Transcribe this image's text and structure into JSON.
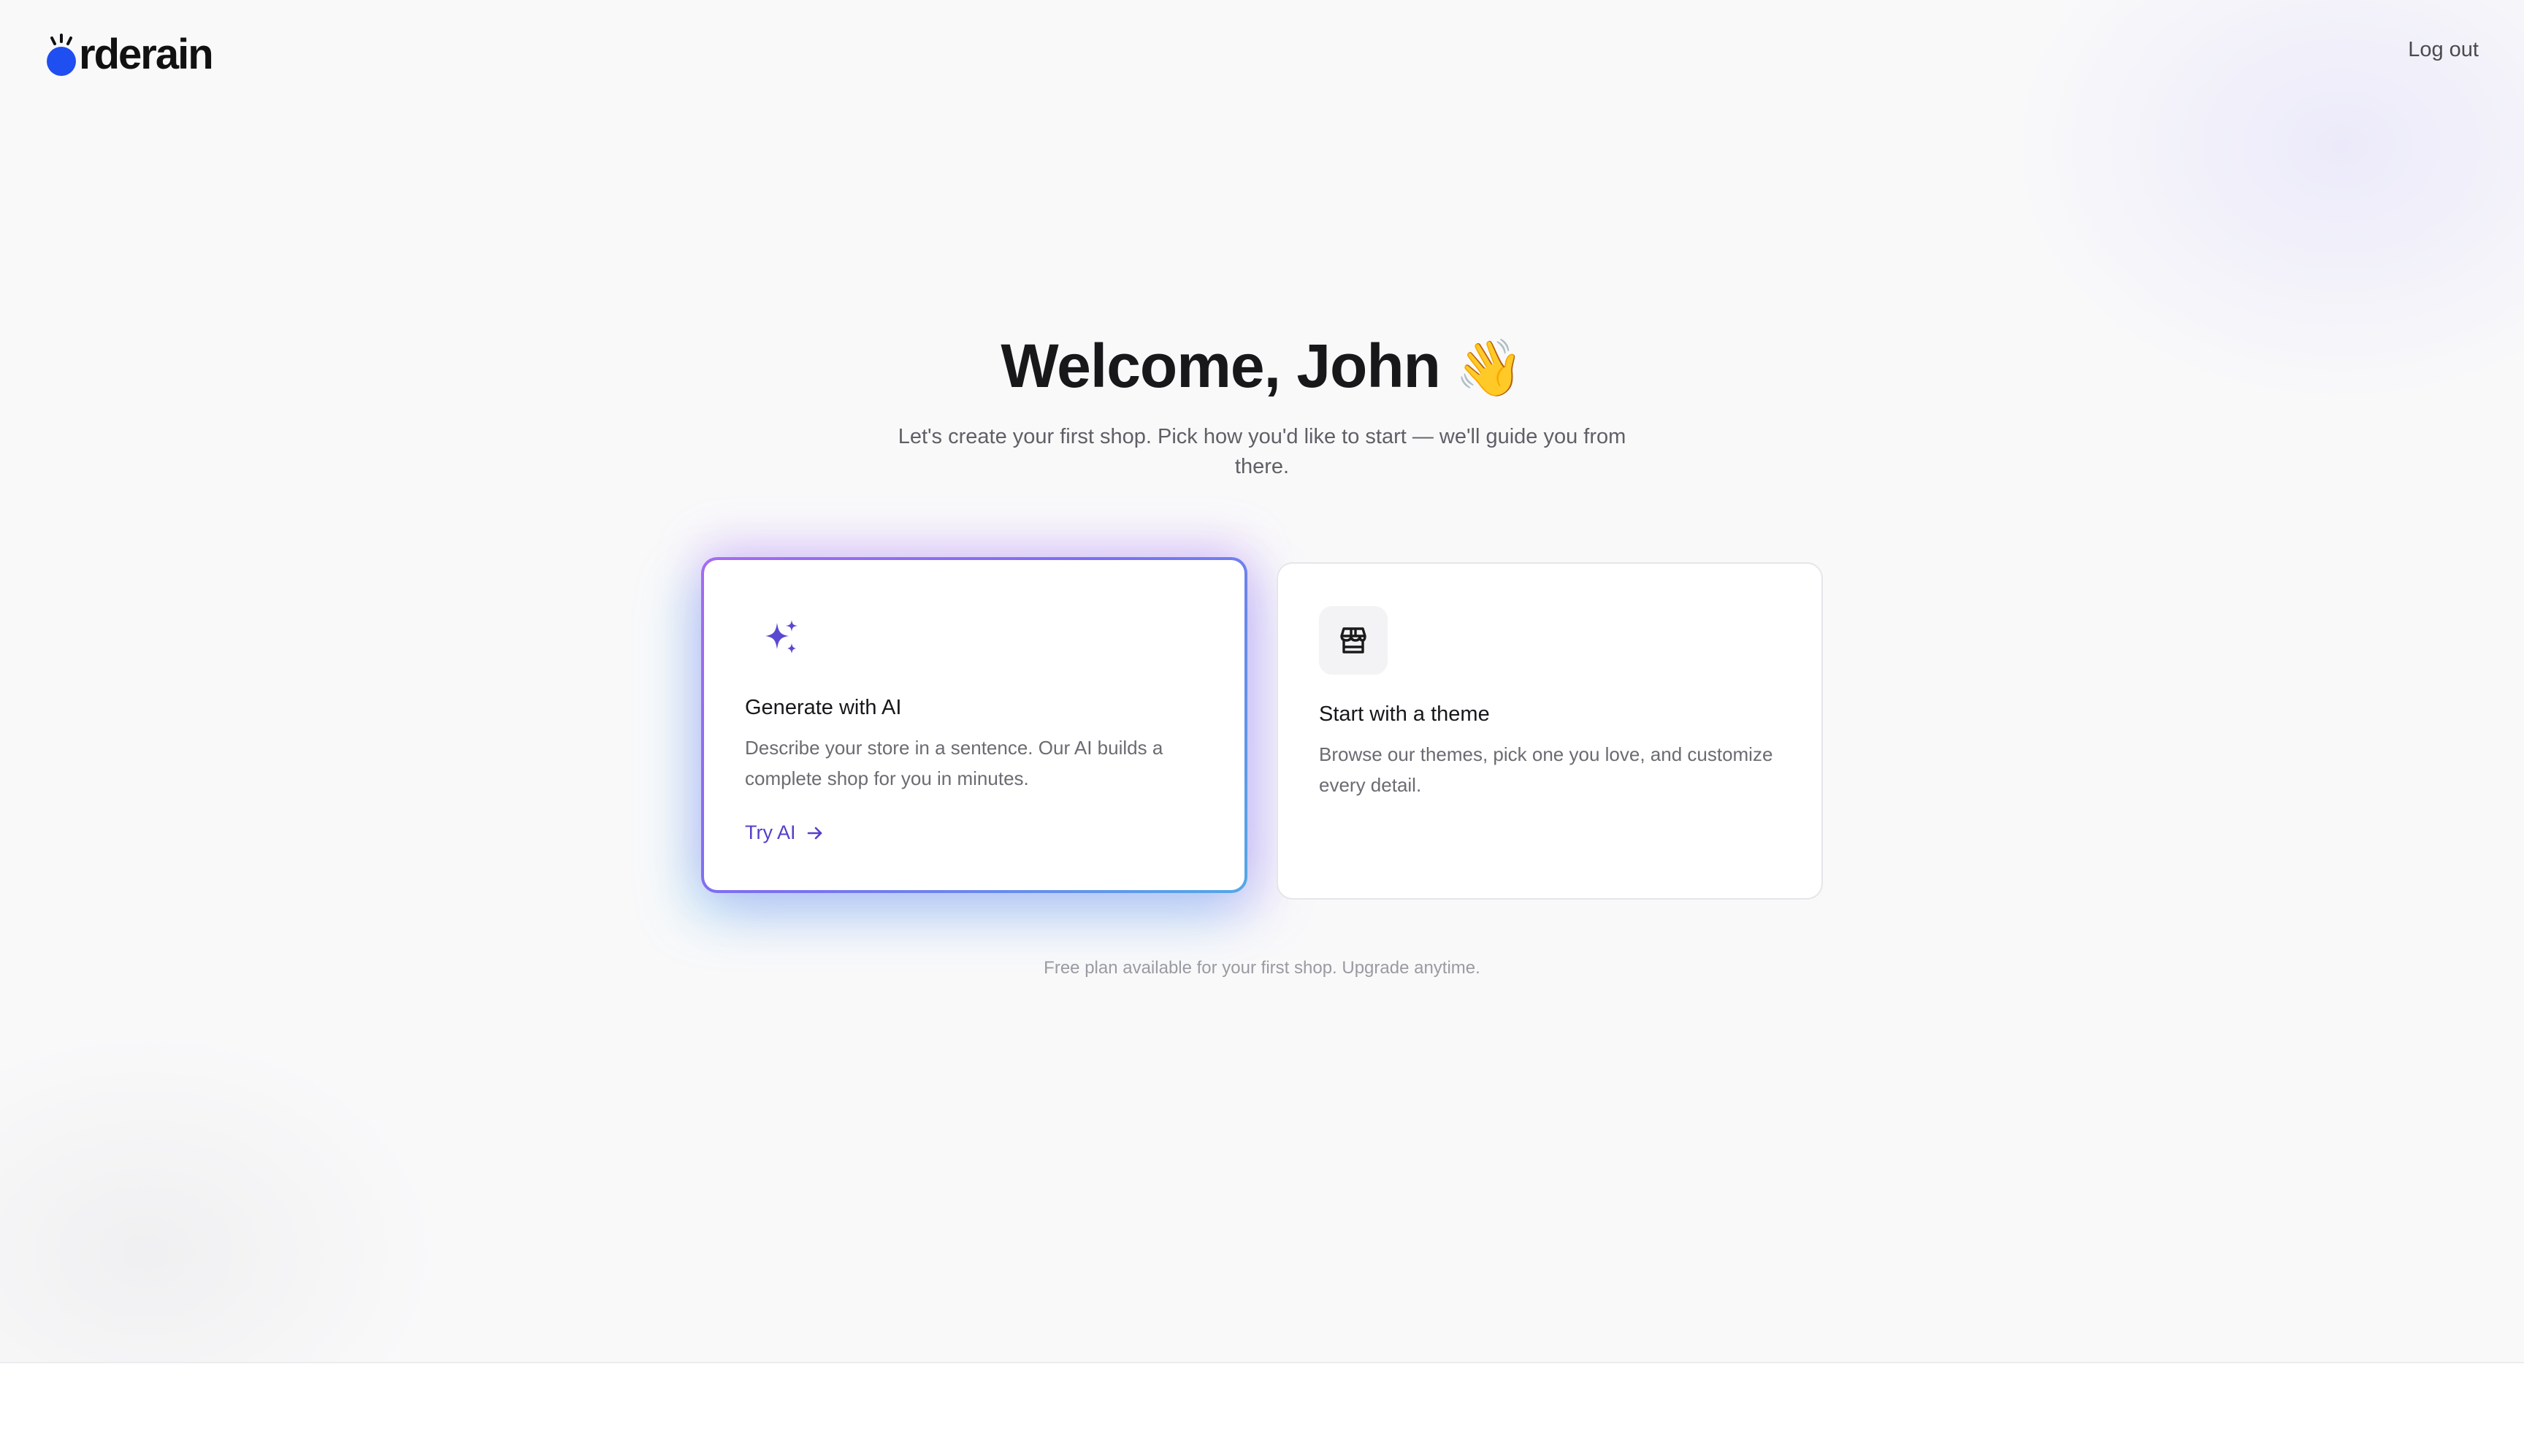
{
  "header": {
    "logo_text": "rderain",
    "logo_letter": "o",
    "logout_label": "Log out"
  },
  "welcome": {
    "title": "Welcome, John",
    "wave_emoji": "👋",
    "subtitle": "Let's create your first shop. Pick how you'd like to start — we'll guide you from there."
  },
  "options": {
    "ai": {
      "icon": "sparkles-icon",
      "title": "Generate with AI",
      "description": "Describe your store in a sentence. Our AI builds a complete shop for you in minutes.",
      "cta_label": "Try AI",
      "selected": true
    },
    "theme": {
      "icon": "storefront-icon",
      "title": "Start with a theme",
      "description": "Browse our themes, pick one you love, and customize every detail."
    }
  },
  "footnote": "Free plan available for your first shop. Upgrade anytime.",
  "colors": {
    "brand_blue": "#1f4ff0",
    "accent_purple": "#5440c8",
    "page_background": "#f9f9fa"
  }
}
